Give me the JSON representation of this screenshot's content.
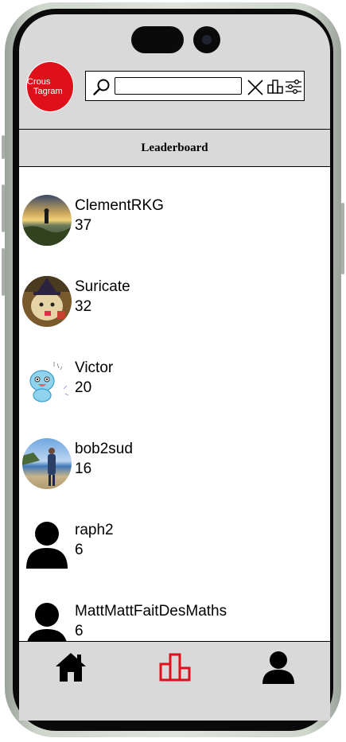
{
  "app": {
    "logo_text_line1": "Crous",
    "logo_text_line2": "Tagram",
    "brand_color": "#e0101b"
  },
  "search": {
    "value": "",
    "placeholder": "",
    "icons": [
      "search-icon",
      "close-icon",
      "leaderboard-icon",
      "filter-sliders-icon"
    ]
  },
  "page": {
    "title": "Leaderboard"
  },
  "leaderboard": {
    "entries": [
      {
        "name": "ClementRKG",
        "score": "37",
        "avatar": "photo-sunset-hiker"
      },
      {
        "name": "Suricate",
        "score": "32",
        "avatar": "photo-dog-witch-hat"
      },
      {
        "name": "Victor",
        "score": "20",
        "avatar": "cartoon-blue-creature"
      },
      {
        "name": "bob2sud",
        "score": "16",
        "avatar": "photo-beach-person"
      },
      {
        "name": "raph2",
        "score": "6",
        "avatar": "default-user-icon"
      },
      {
        "name": "MattMattFaitDesMaths",
        "score": "6",
        "avatar": "default-user-icon"
      }
    ]
  },
  "nav": {
    "items": [
      {
        "icon": "home-icon",
        "active": false
      },
      {
        "icon": "leaderboard-icon",
        "active": true
      },
      {
        "icon": "profile-icon",
        "active": false
      }
    ],
    "active_color": "#e0101b"
  }
}
